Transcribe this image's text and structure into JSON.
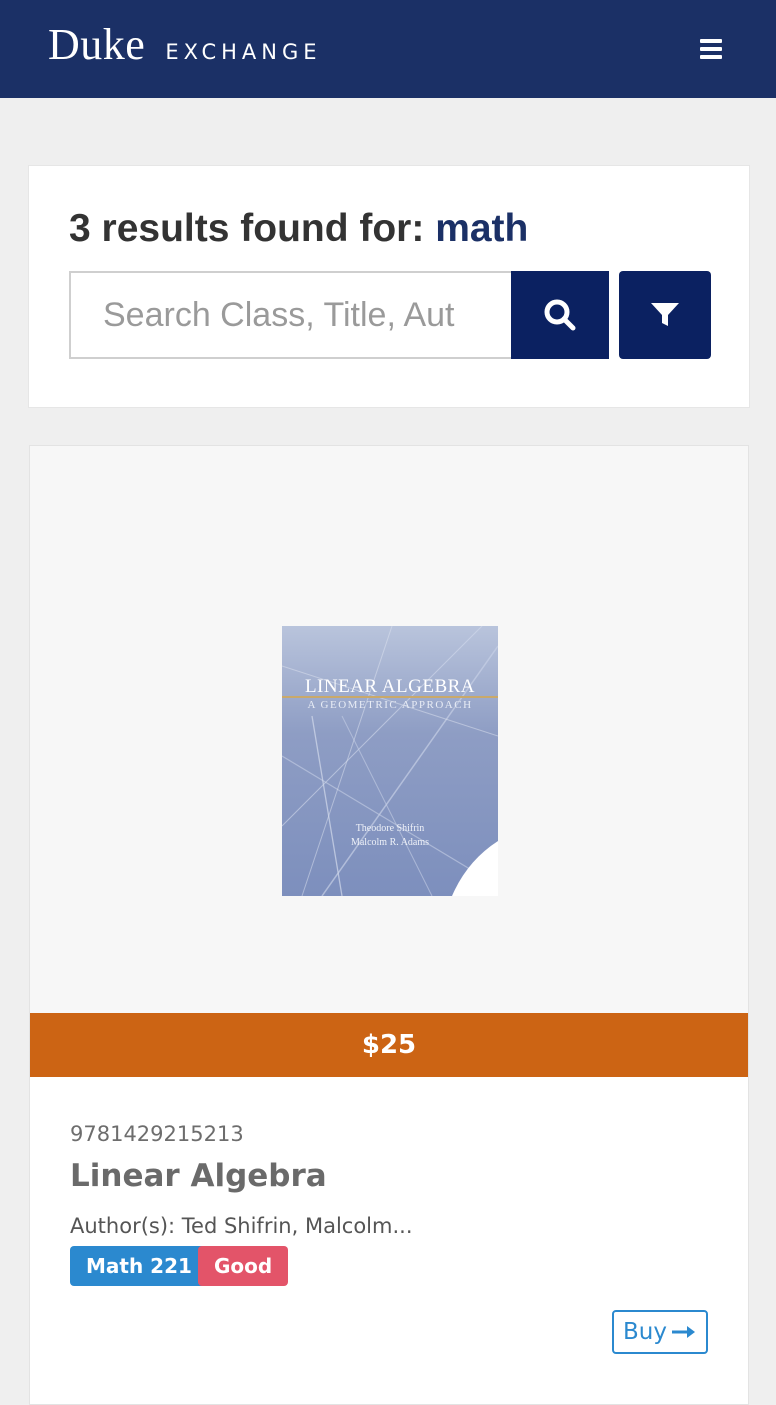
{
  "header": {
    "brand_main": "Duke",
    "brand_sub": "EXCHANGE",
    "menu_icon": "hamburger-menu-icon",
    "background_color": "#1b3066"
  },
  "search": {
    "results_prefix": "3 results found for: ",
    "query": "math",
    "placeholder": "Search Class, Title, Aut",
    "search_icon": "search-icon",
    "filter_icon": "filter-icon",
    "button_color": "#0b2161"
  },
  "results": [
    {
      "cover": {
        "title": "LINEAR ALGEBRA",
        "subtitle": "A GEOMETRIC APPROACH",
        "authors": [
          "Theodore Shifrin",
          "Malcolm R. Adams"
        ]
      },
      "price": "$25",
      "price_color": "#cc6414",
      "isbn": "9781429215213",
      "title": "Linear Algebra",
      "authors": "Author(s): Ted Shifrin, Malcolm...",
      "class_badge": "Math 221",
      "condition_badge": "Good",
      "buy_label": "Buy",
      "buy_icon": "arrow-right-icon"
    }
  ]
}
